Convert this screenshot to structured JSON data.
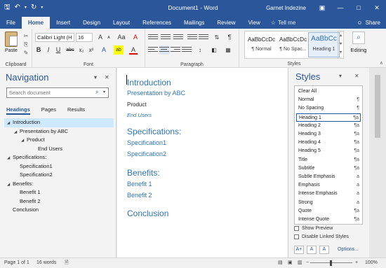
{
  "titlebar": {
    "document_title": "Document1 - Word",
    "user": "Garnet Indezine",
    "icons": [
      "save-icon",
      "undo-icon",
      "redo-icon",
      "customize-icon"
    ]
  },
  "ribbon_tabs": {
    "tabs": [
      "File",
      "Home",
      "Insert",
      "Design",
      "Layout",
      "References",
      "Mailings",
      "Review",
      "View"
    ],
    "active": "Home",
    "tell_me": "Tell me",
    "share": "Share"
  },
  "ribbon": {
    "clipboard": {
      "label": "Clipboard",
      "paste": "Paste"
    },
    "font": {
      "label": "Font",
      "font_name": "Calibri Light (H",
      "font_size": "16",
      "bold": "B",
      "italic": "I",
      "underline": "U",
      "strike": "abc",
      "sub": "x₂",
      "sup": "x²",
      "grow": "A",
      "case": "Aa",
      "clear": "A",
      "highlight": "ab",
      "color": "A"
    },
    "paragraph": {
      "label": "Paragraph"
    },
    "styles": {
      "label": "Styles",
      "gallery": [
        {
          "preview": "AaBbCcDc",
          "name": "¶ Normal"
        },
        {
          "preview": "AaBbCcDc",
          "name": "¶ No Spac..."
        },
        {
          "preview": "AaBbCc",
          "name": "Heading 1"
        }
      ]
    },
    "editing": {
      "label": "Editing"
    }
  },
  "navigation": {
    "title": "Navigation",
    "search_placeholder": "Search document",
    "tabs": [
      "Headings",
      "Pages",
      "Results"
    ],
    "active_tab": "Headings",
    "tree": [
      {
        "text": "Introduction",
        "level": 0,
        "expander": "◢",
        "selected": true
      },
      {
        "text": "Presentation by ABC",
        "level": 1,
        "expander": "◢"
      },
      {
        "text": "Product",
        "level": 2,
        "expander": "◢"
      },
      {
        "text": "End Users",
        "level": 3,
        "expander": ""
      },
      {
        "text": "Specifications:",
        "level": 0,
        "expander": "◢"
      },
      {
        "text": "Specification1",
        "level": 1,
        "expander": ""
      },
      {
        "text": "Specification2",
        "level": 1,
        "expander": ""
      },
      {
        "text": "Benefits:",
        "level": 0,
        "expander": "◢"
      },
      {
        "text": "Benefit 1",
        "level": 1,
        "expander": ""
      },
      {
        "text": "Benefit 2",
        "level": 1,
        "expander": ""
      },
      {
        "text": "Conclusion",
        "level": 0,
        "expander": ""
      }
    ]
  },
  "document": {
    "lines": [
      {
        "text": "Introduction",
        "style": "h1"
      },
      {
        "text": "Presentation by ABC",
        "style": "h2"
      },
      {
        "text": "Product",
        "style": "h3"
      },
      {
        "text": "End Users",
        "style": "h4"
      },
      {
        "text": "Specifications:",
        "style": "h1"
      },
      {
        "text": "Specification1",
        "style": "h2"
      },
      {
        "text": "Specification2",
        "style": "h2"
      },
      {
        "text": "Benefits:",
        "style": "h1"
      },
      {
        "text": "Benefit 1",
        "style": "h2"
      },
      {
        "text": "Benefit 2",
        "style": "h2"
      },
      {
        "text": "Conclusion",
        "style": "h1"
      }
    ]
  },
  "styles_pane": {
    "title": "Styles",
    "items": [
      {
        "name": "Clear All",
        "mark": ""
      },
      {
        "name": "Normal",
        "mark": "¶"
      },
      {
        "name": "No Spacing",
        "mark": "¶"
      },
      {
        "name": "Heading 1",
        "mark": "¶a",
        "selected": true
      },
      {
        "name": "Heading 2",
        "mark": "¶a"
      },
      {
        "name": "Heading 3",
        "mark": "¶a"
      },
      {
        "name": "Heading 4",
        "mark": "¶a"
      },
      {
        "name": "Heading 5",
        "mark": "¶a"
      },
      {
        "name": "Title",
        "mark": "¶a"
      },
      {
        "name": "Subtitle",
        "mark": "¶a"
      },
      {
        "name": "Subtle Emphasis",
        "mark": "a"
      },
      {
        "name": "Emphasis",
        "mark": "a"
      },
      {
        "name": "Intense Emphasis",
        "mark": "a"
      },
      {
        "name": "Strong",
        "mark": "a"
      },
      {
        "name": "Quote",
        "mark": "¶a"
      },
      {
        "name": "Intense Quote",
        "mark": "¶a"
      }
    ],
    "show_preview": "Show Preview",
    "disable_linked": "Disable Linked Styles",
    "options": "Options..."
  },
  "statusbar": {
    "page": "Page 1 of 1",
    "words": "16 words",
    "zoom": "100%"
  },
  "colors": {
    "accent": "#2b579a",
    "heading": "#2e74b5",
    "nav_selected": "#cde8ff"
  }
}
